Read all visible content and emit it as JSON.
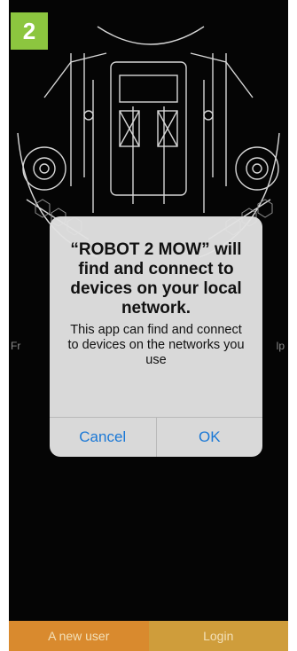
{
  "step": {
    "number": "2"
  },
  "background": {
    "left_fragment": "Fr",
    "right_fragment": "lp"
  },
  "dialog": {
    "title": "“ROBOT 2 MOW” will find and connect to devices on your local network.",
    "message": "This app can find and connect to devices on the networks you use",
    "cancel_label": "Cancel",
    "ok_label": "OK"
  },
  "bottom_bar": {
    "new_user_label": "A new user",
    "login_label": "Login"
  },
  "colors": {
    "badge": "#8cc63f",
    "accent_blue": "#1a78d6",
    "new_user_bg": "#d98a2e",
    "login_bg": "#cf9d3b"
  }
}
